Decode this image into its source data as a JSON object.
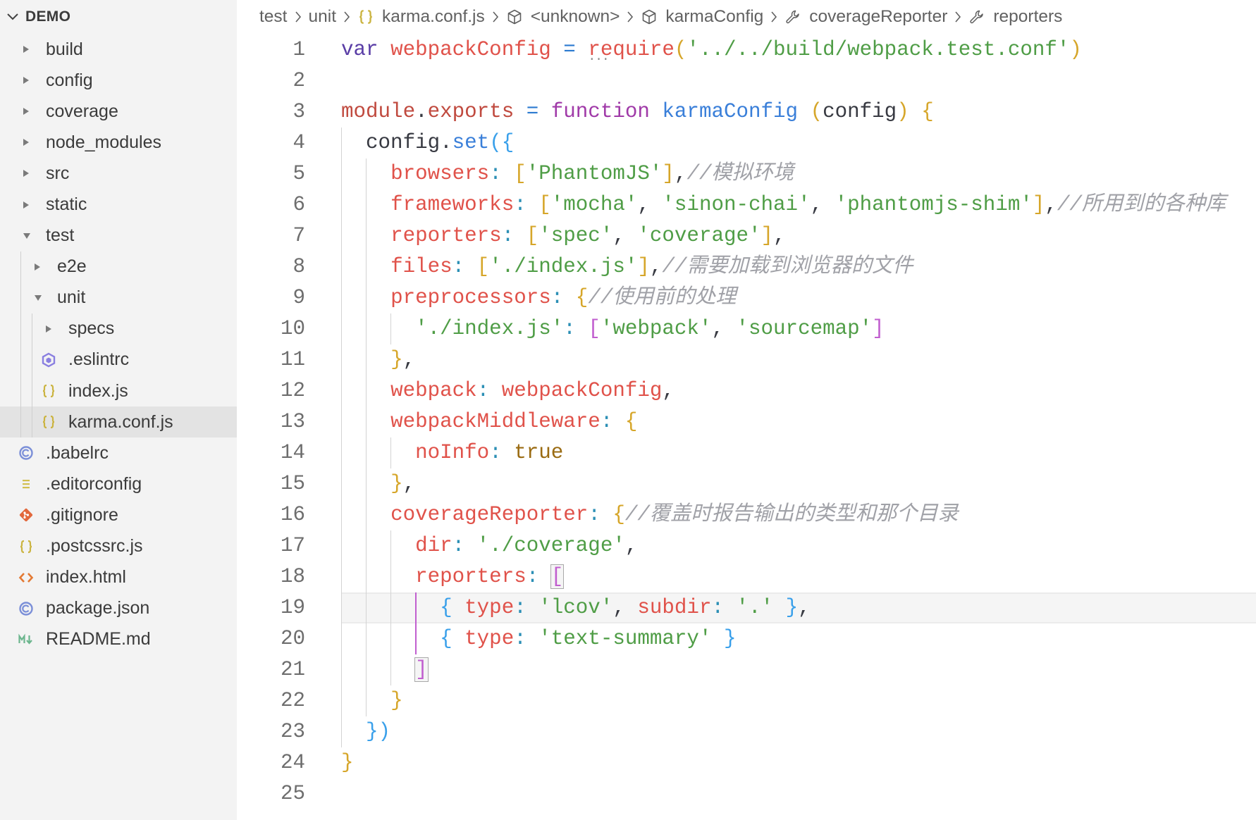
{
  "explorer": {
    "title": "DEMO",
    "items": [
      {
        "label": "build",
        "type": "folder",
        "expanded": false
      },
      {
        "label": "config",
        "type": "folder",
        "expanded": false
      },
      {
        "label": "coverage",
        "type": "folder",
        "expanded": false
      },
      {
        "label": "node_modules",
        "type": "folder",
        "expanded": false
      },
      {
        "label": "src",
        "type": "folder",
        "expanded": false
      },
      {
        "label": "static",
        "type": "folder",
        "expanded": false
      },
      {
        "label": "test",
        "type": "folder",
        "expanded": true,
        "children": [
          {
            "label": "e2e",
            "type": "folder",
            "expanded": false
          },
          {
            "label": "unit",
            "type": "folder",
            "expanded": true,
            "children": [
              {
                "label": "specs",
                "type": "folder",
                "expanded": false
              },
              {
                "label": ".eslintrc",
                "type": "file",
                "icon": "eslint-icon"
              },
              {
                "label": "index.js",
                "type": "file",
                "icon": "javascript-icon"
              },
              {
                "label": "karma.conf.js",
                "type": "file",
                "icon": "javascript-icon",
                "selected": true
              }
            ]
          }
        ]
      },
      {
        "label": ".babelrc",
        "type": "file",
        "icon": "babel-icon"
      },
      {
        "label": ".editorconfig",
        "type": "file",
        "icon": "editorconfig-icon"
      },
      {
        "label": ".gitignore",
        "type": "file",
        "icon": "git-icon"
      },
      {
        "label": ".postcssrc.js",
        "type": "file",
        "icon": "javascript-icon"
      },
      {
        "label": "index.html",
        "type": "file",
        "icon": "html-icon"
      },
      {
        "label": "package.json",
        "type": "file",
        "icon": "package-icon"
      },
      {
        "label": "README.md",
        "type": "file",
        "icon": "markdown-icon"
      }
    ]
  },
  "breadcrumb": {
    "items": [
      {
        "label": "test"
      },
      {
        "label": "unit"
      },
      {
        "label": "karma.conf.js",
        "icon": "javascript-icon"
      },
      {
        "label": "<unknown>",
        "icon": "module-icon"
      },
      {
        "label": "karmaConfig",
        "icon": "module-icon"
      },
      {
        "label": "coverageReporter",
        "icon": "property-icon"
      },
      {
        "label": "reporters",
        "icon": "property-icon"
      }
    ]
  },
  "editor": {
    "cursor_line": 19,
    "bracket_match": {
      "open_line": 18,
      "close_line": 21
    },
    "lines": [
      {
        "n": 1,
        "tokens": [
          [
            "var",
            "kwv"
          ],
          [
            " ",
            "pl"
          ],
          [
            "webpackConfig",
            "var"
          ],
          [
            " = ",
            "op"
          ],
          [
            "require",
            "var hint"
          ],
          [
            "(",
            "b1"
          ],
          [
            "'../../build/webpack.test.conf'",
            "str"
          ],
          [
            ")",
            "b1"
          ]
        ]
      },
      {
        "n": 2,
        "tokens": []
      },
      {
        "n": 3,
        "tokens": [
          [
            "module",
            "obj"
          ],
          [
            ".",
            "pl"
          ],
          [
            "exports",
            "obj"
          ],
          [
            " = ",
            "op"
          ],
          [
            "function",
            "kw"
          ],
          [
            " ",
            "pl"
          ],
          [
            "karmaConfig",
            "fn"
          ],
          [
            " ",
            "pl"
          ],
          [
            "(",
            "b1"
          ],
          [
            "config",
            "prm"
          ],
          [
            ")",
            "b1"
          ],
          [
            " ",
            "pl"
          ],
          [
            "{",
            "b1"
          ]
        ]
      },
      {
        "n": 4,
        "tokens": [
          [
            "  ",
            "ind"
          ],
          [
            "config",
            "prm"
          ],
          [
            ".",
            "pl"
          ],
          [
            "set",
            "fn"
          ],
          [
            "(",
            "b3"
          ],
          [
            "{",
            "b3"
          ]
        ]
      },
      {
        "n": 5,
        "tokens": [
          [
            "    ",
            "ind"
          ],
          [
            "browsers",
            "prop"
          ],
          [
            ": ",
            "col"
          ],
          [
            "[",
            "b1"
          ],
          [
            "'PhantomJS'",
            "str"
          ],
          [
            "]",
            "b1"
          ],
          [
            ",",
            "pl"
          ],
          [
            "//模拟环境",
            "cmt"
          ]
        ]
      },
      {
        "n": 6,
        "tokens": [
          [
            "    ",
            "ind"
          ],
          [
            "frameworks",
            "prop"
          ],
          [
            ": ",
            "col"
          ],
          [
            "[",
            "b1"
          ],
          [
            "'mocha'",
            "str"
          ],
          [
            ", ",
            "pl"
          ],
          [
            "'sinon-chai'",
            "str"
          ],
          [
            ", ",
            "pl"
          ],
          [
            "'phantomjs-shim'",
            "str"
          ],
          [
            "]",
            "b1"
          ],
          [
            ",",
            "pl"
          ],
          [
            "//所用到的各种库",
            "cmt"
          ]
        ]
      },
      {
        "n": 7,
        "tokens": [
          [
            "    ",
            "ind"
          ],
          [
            "reporters",
            "prop"
          ],
          [
            ": ",
            "col"
          ],
          [
            "[",
            "b1"
          ],
          [
            "'spec'",
            "str"
          ],
          [
            ", ",
            "pl"
          ],
          [
            "'coverage'",
            "str"
          ],
          [
            "]",
            "b1"
          ],
          [
            ",",
            "pl"
          ]
        ]
      },
      {
        "n": 8,
        "tokens": [
          [
            "    ",
            "ind"
          ],
          [
            "files",
            "prop"
          ],
          [
            ": ",
            "col"
          ],
          [
            "[",
            "b1"
          ],
          [
            "'./index.js'",
            "str"
          ],
          [
            "]",
            "b1"
          ],
          [
            ",",
            "pl"
          ],
          [
            "//需要加载到浏览器的文件",
            "cmt"
          ]
        ]
      },
      {
        "n": 9,
        "tokens": [
          [
            "    ",
            "ind"
          ],
          [
            "preprocessors",
            "prop"
          ],
          [
            ": ",
            "col"
          ],
          [
            "{",
            "b1"
          ],
          [
            "//使用前的处理",
            "cmt"
          ]
        ]
      },
      {
        "n": 10,
        "tokens": [
          [
            "      ",
            "ind"
          ],
          [
            "'./index.js'",
            "str"
          ],
          [
            ": ",
            "col"
          ],
          [
            "[",
            "b2"
          ],
          [
            "'webpack'",
            "str"
          ],
          [
            ", ",
            "pl"
          ],
          [
            "'sourcemap'",
            "str"
          ],
          [
            "]",
            "b2"
          ]
        ]
      },
      {
        "n": 11,
        "tokens": [
          [
            "    ",
            "ind"
          ],
          [
            "}",
            "b1"
          ],
          [
            ",",
            "pl"
          ]
        ]
      },
      {
        "n": 12,
        "tokens": [
          [
            "    ",
            "ind"
          ],
          [
            "webpack",
            "prop"
          ],
          [
            ": ",
            "col"
          ],
          [
            "webpackConfig",
            "var"
          ],
          [
            ",",
            "pl"
          ]
        ]
      },
      {
        "n": 13,
        "tokens": [
          [
            "    ",
            "ind"
          ],
          [
            "webpackMiddleware",
            "prop"
          ],
          [
            ": ",
            "col"
          ],
          [
            "{",
            "b1"
          ]
        ]
      },
      {
        "n": 14,
        "tokens": [
          [
            "      ",
            "ind"
          ],
          [
            "noInfo",
            "prop"
          ],
          [
            ": ",
            "col"
          ],
          [
            "true",
            "bool"
          ]
        ]
      },
      {
        "n": 15,
        "tokens": [
          [
            "    ",
            "ind"
          ],
          [
            "}",
            "b1"
          ],
          [
            ",",
            "pl"
          ]
        ]
      },
      {
        "n": 16,
        "tokens": [
          [
            "    ",
            "ind"
          ],
          [
            "coverageReporter",
            "prop"
          ],
          [
            ": ",
            "col"
          ],
          [
            "{",
            "b1"
          ],
          [
            "//覆盖时报告输出的类型和那个目录",
            "cmt"
          ]
        ]
      },
      {
        "n": 17,
        "tokens": [
          [
            "      ",
            "ind"
          ],
          [
            "dir",
            "prop"
          ],
          [
            ": ",
            "col"
          ],
          [
            "'./coverage'",
            "str"
          ],
          [
            ",",
            "pl"
          ]
        ]
      },
      {
        "n": 18,
        "tokens": [
          [
            "      ",
            "ind"
          ],
          [
            "reporters",
            "prop"
          ],
          [
            ": ",
            "col"
          ],
          [
            "[",
            "b2 m"
          ]
        ]
      },
      {
        "n": 19,
        "tokens": [
          [
            "        ",
            "ind"
          ],
          [
            "{",
            "b3"
          ],
          [
            " ",
            "pl"
          ],
          [
            "type",
            "prop"
          ],
          [
            ": ",
            "col"
          ],
          [
            "'lcov'",
            "str"
          ],
          [
            ", ",
            "pl"
          ],
          [
            "subdir",
            "prop"
          ],
          [
            ": ",
            "col"
          ],
          [
            "'.'",
            "str"
          ],
          [
            " ",
            "pl"
          ],
          [
            "}",
            "b3"
          ],
          [
            ",",
            "pl"
          ]
        ]
      },
      {
        "n": 20,
        "tokens": [
          [
            "        ",
            "ind"
          ],
          [
            "{",
            "b3"
          ],
          [
            " ",
            "pl"
          ],
          [
            "type",
            "prop"
          ],
          [
            ": ",
            "col"
          ],
          [
            "'text-summary'",
            "str"
          ],
          [
            " ",
            "pl"
          ],
          [
            "}",
            "b3"
          ]
        ]
      },
      {
        "n": 21,
        "tokens": [
          [
            "      ",
            "ind"
          ],
          [
            "]",
            "b2 m"
          ]
        ]
      },
      {
        "n": 22,
        "tokens": [
          [
            "    ",
            "ind"
          ],
          [
            "}",
            "b1"
          ]
        ]
      },
      {
        "n": 23,
        "tokens": [
          [
            "  ",
            "ind"
          ],
          [
            "}",
            "b3"
          ],
          [
            ")",
            "b3"
          ]
        ]
      },
      {
        "n": 24,
        "tokens": [
          [
            "}",
            "b1"
          ]
        ]
      },
      {
        "n": 25,
        "tokens": []
      }
    ]
  },
  "theme": {
    "sidebar_bg": "#f3f3f3",
    "selection_bg": "#e3e3e3",
    "syntax": {
      "pl": "#383a42",
      "ind": "#383a42",
      "kw": "#a03aa8",
      "kwv": "#5a3ea6",
      "var": "#e0524a",
      "prop": "#e0524a",
      "obj": "#c04a3f",
      "op": "#2b7ad0",
      "col": "#2b8fb5",
      "str": "#4f9d46",
      "fn": "#3a7fd9",
      "prm": "#383a42",
      "bool": "#9a6b12",
      "cmt": "#a0a1a7",
      "b1": "#d6a62a",
      "b2": "#c15fcf",
      "b3": "#3aa0ea"
    },
    "icons": {
      "eslint-icon": "#8a7fe0",
      "javascript-icon": "#cbb441",
      "babel-icon": "#7b8fd8",
      "package-icon": "#7b8fd8",
      "editorconfig-icon": "#d2bf4f",
      "git-icon": "#e2683c",
      "html-icon": "#e37933",
      "markdown-icon": "#6cb68e",
      "module-icon": "#5f5f5f",
      "property-icon": "#5f5f5f"
    }
  }
}
